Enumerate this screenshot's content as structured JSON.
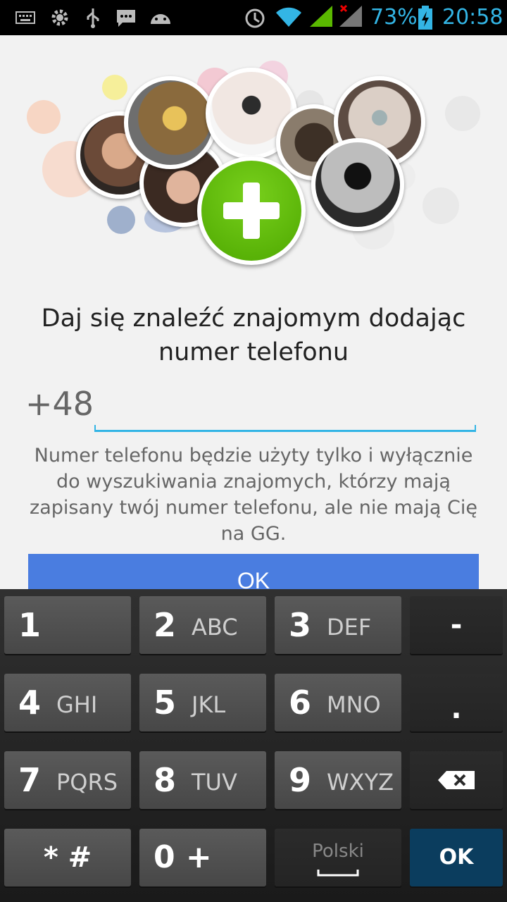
{
  "status_bar": {
    "battery_percent": "73%",
    "time": "20:58",
    "icons": [
      "keyboard-icon",
      "settings-icon",
      "usb-icon",
      "message-icon",
      "android-icon",
      "alarm-icon",
      "wifi-icon",
      "signal-icon",
      "no-signal-icon",
      "battery-charging-icon"
    ]
  },
  "hero": {
    "icon": "add-plus-icon",
    "accent_color": "#5ab800"
  },
  "headline": "Daj się znaleźć znajomym dodając numer telefonu",
  "phone": {
    "prefix": "+48",
    "value": "",
    "placeholder": ""
  },
  "note": "Numer telefonu będzie użyty tylko i wyłącznie do wyszukiwania znajomych, którzy mają zapisany twój numer telefonu, ale nie mają Cię na GG.",
  "ok_button": "OK",
  "keyboard": {
    "rows": [
      [
        {
          "num": "1",
          "letters": ""
        },
        {
          "num": "2",
          "letters": "ABC"
        },
        {
          "num": "3",
          "letters": "DEF"
        },
        {
          "label": "-"
        }
      ],
      [
        {
          "num": "4",
          "letters": "GHI"
        },
        {
          "num": "5",
          "letters": "JKL"
        },
        {
          "num": "6",
          "letters": "MNO"
        },
        {
          "label": "."
        }
      ],
      [
        {
          "num": "7",
          "letters": "PQRS"
        },
        {
          "num": "8",
          "letters": "TUV"
        },
        {
          "num": "9",
          "letters": "WXYZ"
        },
        {
          "icon": "backspace-icon"
        }
      ],
      [
        {
          "label": "* #"
        },
        {
          "label": "0 +"
        },
        {
          "label": "Polski"
        },
        {
          "label": "OK"
        }
      ]
    ]
  },
  "colors": {
    "accent": "#33b5e5",
    "ok_button_bg": "#4a7de0",
    "keyboard_ok_bg": "#0b3d5e"
  }
}
